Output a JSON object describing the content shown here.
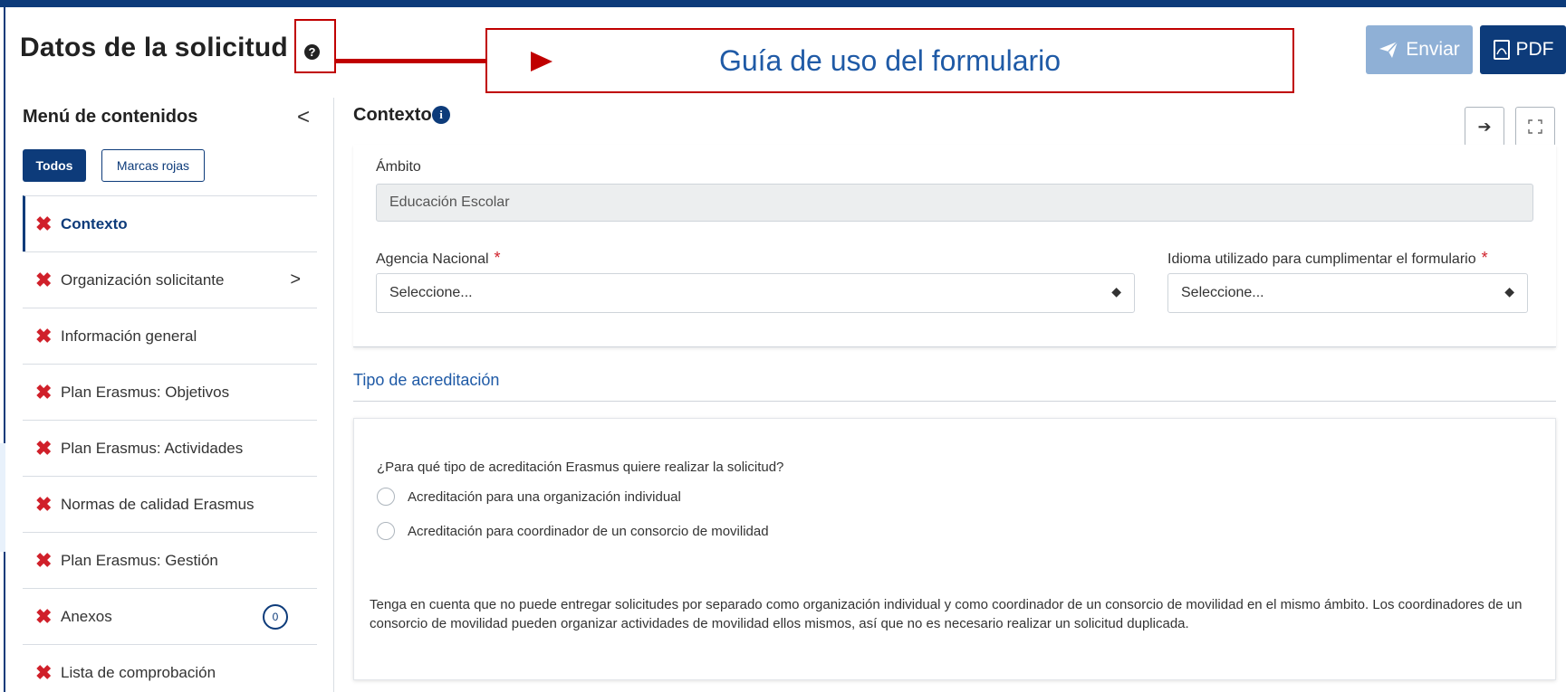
{
  "header": {
    "title": "Datos de la solicitud",
    "help_glyph": "?",
    "guide_callout": "Guía de uso del formulario",
    "send_label": "Enviar",
    "pdf_label": "PDF"
  },
  "sidebar": {
    "title": "Menú de contenidos",
    "collapse_glyph": "<",
    "filters": {
      "all": "Todos",
      "red_flags": "Marcas rojas"
    },
    "items": [
      {
        "label": "Contexto",
        "active": true
      },
      {
        "label": "Organización solicitante",
        "chevron": ">"
      },
      {
        "label": "Información general"
      },
      {
        "label": "Plan Erasmus: Objetivos"
      },
      {
        "label": "Plan Erasmus: Actividades"
      },
      {
        "label": "Normas de calidad Erasmus"
      },
      {
        "label": "Plan Erasmus: Gestión"
      },
      {
        "label": "Anexos",
        "count": "0"
      },
      {
        "label": "Lista de comprobación"
      }
    ]
  },
  "main": {
    "section_title": "Contexto",
    "info_glyph": "i",
    "fields": {
      "ambito_label": "Ámbito",
      "ambito_value": "Educación Escolar",
      "agency_label": "Agencia Nacional",
      "agency_value": "Seleccione...",
      "language_label": "Idioma utilizado para cumplimentar el formulario",
      "language_value": "Seleccione...",
      "required_mark": "*"
    },
    "accreditation": {
      "title": "Tipo de acreditación",
      "question": "¿Para qué tipo de acreditación Erasmus quiere realizar la solicitud?",
      "options": [
        "Acreditación para una organización individual",
        "Acreditación para coordinador de un consorcio de movilidad"
      ],
      "note": "Tenga en cuenta que no puede entregar solicitudes por separado como organización individual y como coordinador de un consorcio de movilidad en el mismo ámbito. Los coordinadores de un consorcio de movilidad pueden organizar actividades de movilidad ellos mismos, así que no es necesario realizar un solicitud duplicada."
    }
  },
  "colors": {
    "brand": "#0d3b7a",
    "brand_disabled": "#8fb0d6",
    "error": "#d0202a",
    "annotation": "#c00000",
    "link": "#1f5aa6"
  },
  "icons": {
    "send": "paper-plane-icon",
    "pdf": "pdf-icon",
    "status": "x-icon",
    "next": "arrow-right-icon",
    "fullscreen": "expand-icon",
    "info": "info-icon",
    "help": "question-circle-icon"
  }
}
